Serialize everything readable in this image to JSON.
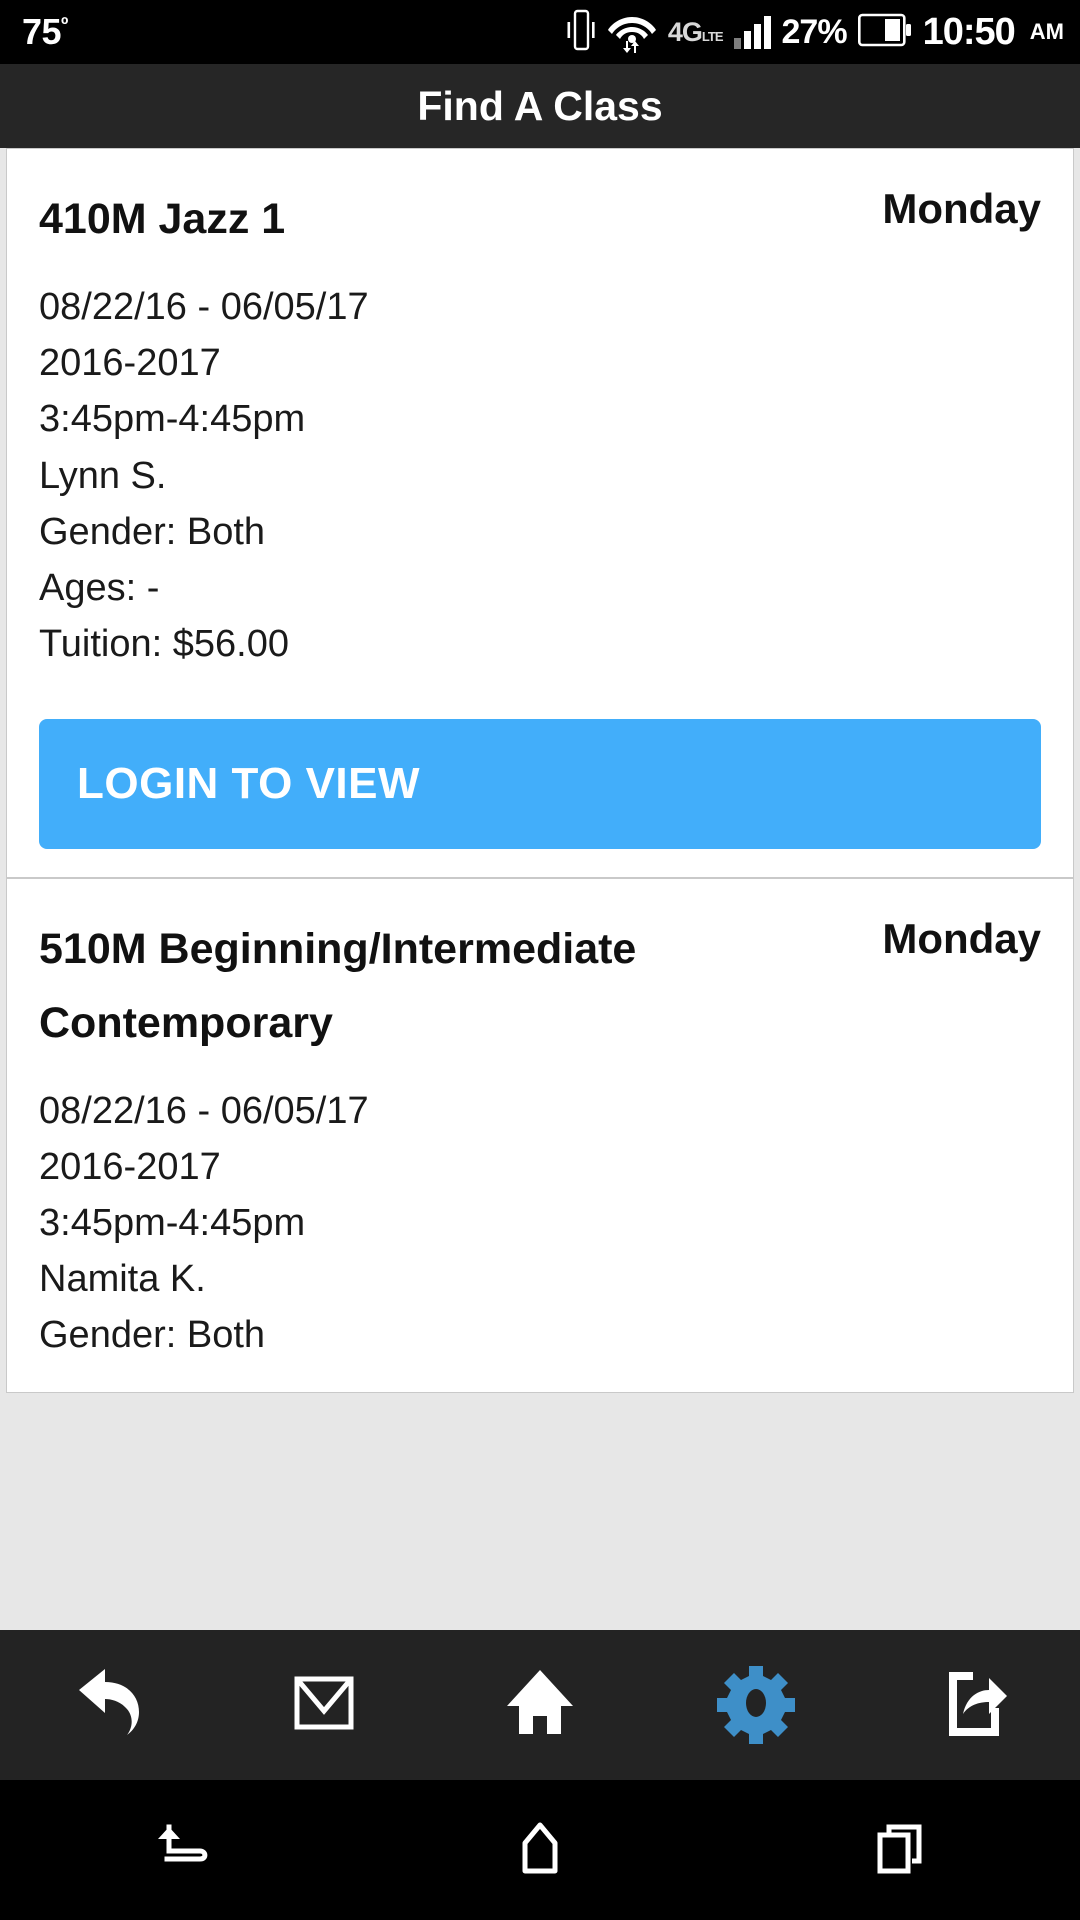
{
  "status_bar": {
    "temperature": "75",
    "temperature_unit": "º",
    "vibrate_icon": "vibrate-icon",
    "wifi_icon": "wifi-icon",
    "network_label": "4G",
    "network_sub": "LTE",
    "signal_icon": "signal-bars-icon",
    "battery_percent": "27%",
    "battery_icon": "battery-icon",
    "time": "10:50",
    "meridiem": "AM"
  },
  "header": {
    "title": "Find A Class"
  },
  "classes": [
    {
      "code_title": "410M Jazz 1",
      "day": "Monday",
      "date_range": "08/22/16 - 06/05/17",
      "season": "2016-2017",
      "time_range": "3:45pm-4:45pm",
      "instructor": "Lynn S.",
      "gender": "Gender: Both",
      "ages": "Ages: -",
      "tuition": "Tuition: $56.00",
      "action_label": "LOGIN TO VIEW"
    },
    {
      "code_title": "510M Beginning/Intermediate Contemporary",
      "day": "Monday",
      "date_range": "08/22/16 - 06/05/17",
      "season": "2016-2017",
      "time_range": "3:45pm-4:45pm",
      "instructor": "Namita K.",
      "gender": "Gender: Both"
    }
  ],
  "app_toolbar": {
    "items": [
      {
        "name": "back-icon",
        "label": "Back"
      },
      {
        "name": "mail-icon",
        "label": "Mail"
      },
      {
        "name": "home-icon",
        "label": "Home"
      },
      {
        "name": "gear-icon",
        "label": "Settings"
      },
      {
        "name": "share-icon",
        "label": "Share"
      }
    ]
  },
  "nav_bar": {
    "items": [
      {
        "name": "android-back-icon",
        "label": "Back"
      },
      {
        "name": "android-home-icon",
        "label": "Home"
      },
      {
        "name": "android-recents-icon",
        "label": "Recents"
      }
    ]
  },
  "colors": {
    "accent_button": "#42aefa",
    "accent_gear": "#3e8fc8",
    "toolbar_bg": "#232323",
    "titlebar_bg": "#262626",
    "navbar_bg": "#000000"
  }
}
